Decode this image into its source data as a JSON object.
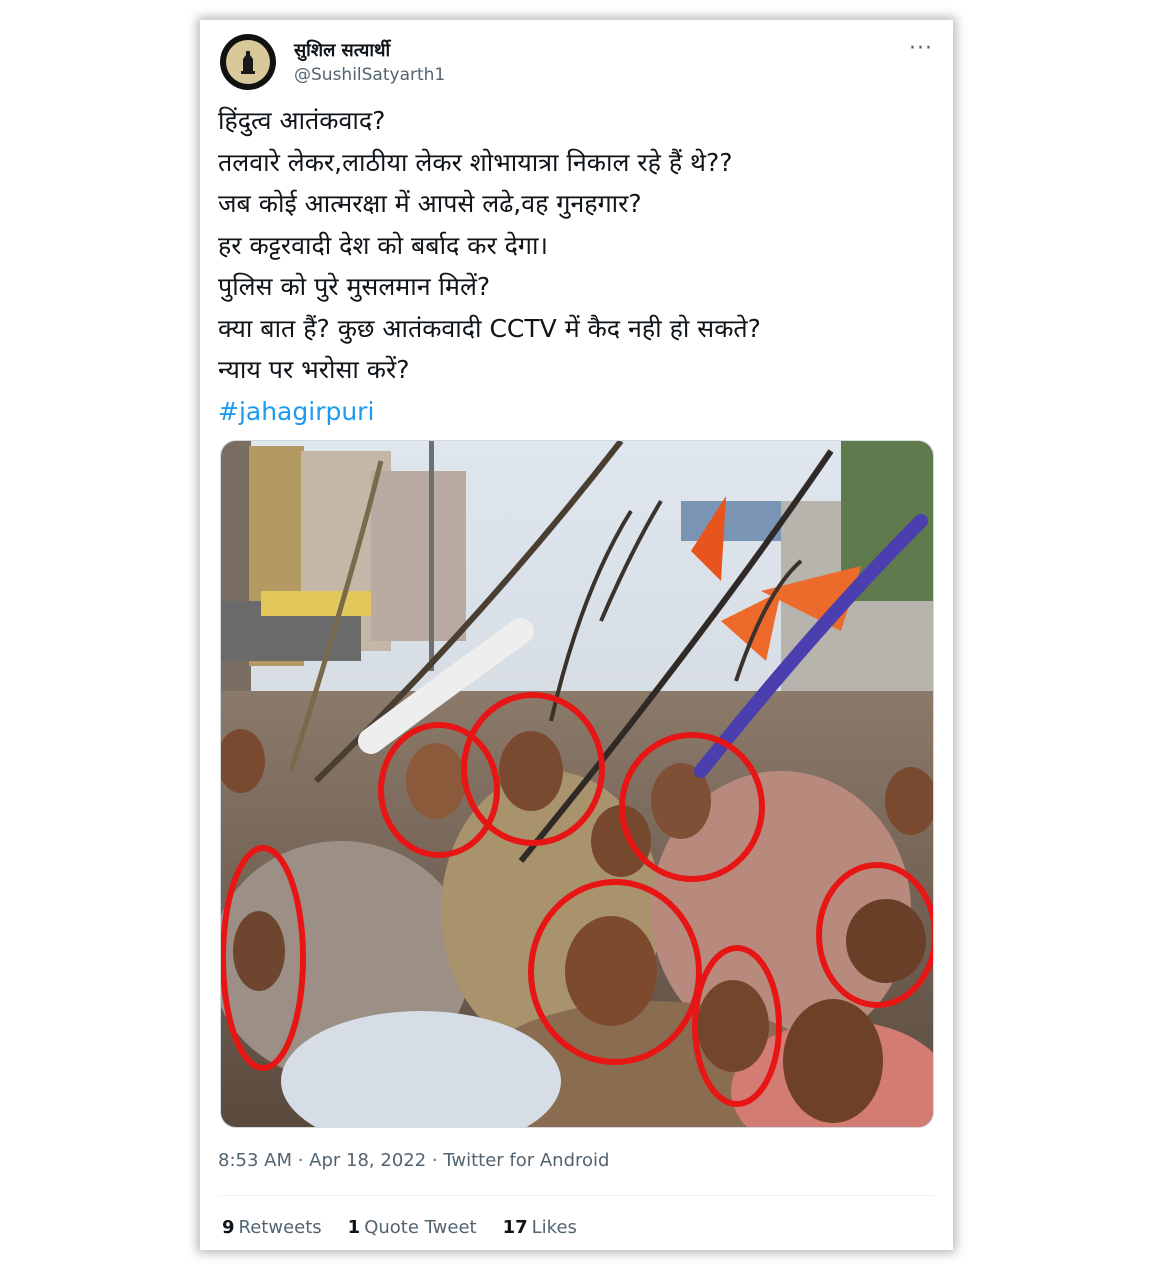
{
  "tweet": {
    "author_name": "सुशिल सत्यार्थी",
    "author_handle": "@SushilSatyarth1",
    "more_label": "···",
    "lines": [
      "हिंदुत्व आतंकवाद?",
      "तलवारे लेकर,लाठीया लेकर शोभायात्रा निकाल रहे हैं थे??",
      "जब कोई आत्मरक्षा में आपसे लढे,वह गुनहगार?",
      "हर कट्टरवादी देश को बर्बाद कर देगा।",
      "पुलिस को पुरे मुसलमान मिलें?",
      "क्या बात हैं? कुछ आतंकवादी CCTV में कैद नही हो सकते?",
      "न्याय पर भरोसा करें?"
    ],
    "hashtag": "#jahagirpuri",
    "timestamp": "8:53 AM · Apr 18, 2022 · Twitter for Android",
    "stats": {
      "retweets_count": "9",
      "retweets_label": "Retweets",
      "quotes_count": "1",
      "quotes_label": "Quote Tweet",
      "likes_count": "17",
      "likes_label": "Likes"
    }
  },
  "colors": {
    "hashtag": "#1d9bf0",
    "circle_annotation": "#e81515",
    "flag": "#e8551c"
  },
  "icons": {
    "avatar": "profile-logo-icon",
    "more": "more-options-icon"
  }
}
